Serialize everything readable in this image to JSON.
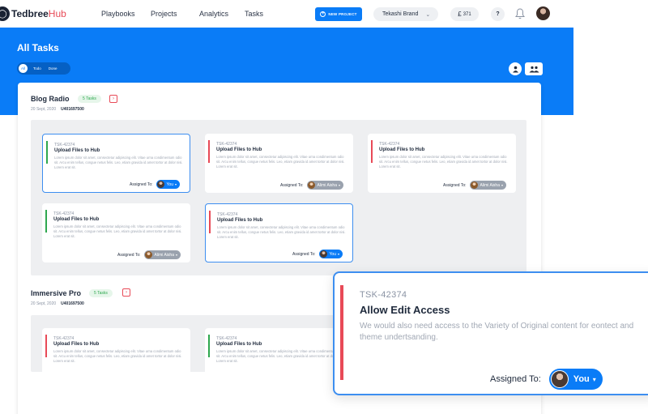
{
  "app": {
    "name": "Tedbree",
    "name_suffix": "Hub",
    "logo_icon": "tedbree-logo-icon"
  },
  "nav": {
    "links": [
      {
        "label": "Playbooks"
      },
      {
        "label": "Projects"
      },
      {
        "label": "Analytics"
      },
      {
        "label": "Tasks"
      }
    ],
    "new_project_label": "NEW PROJECT",
    "brand_select": "Tekashi Brand",
    "credit_symbol": "£",
    "credit_value": "371",
    "help_label": "?",
    "icons": [
      "plus-circle-icon",
      "chevron-down-icon",
      "question-icon",
      "bell-icon",
      "avatar"
    ]
  },
  "hero": {
    "title": "All Tasks",
    "filters": [
      {
        "label": "All",
        "active": true
      },
      {
        "label": "Todo"
      },
      {
        "label": "Done"
      }
    ],
    "view_icons": [
      "user-view-icon",
      "team-view-icon"
    ]
  },
  "colors": {
    "primary": "#0a7cf7",
    "accent_red": "#e84a57",
    "accent_green": "#2fa84f"
  },
  "projects": [
    {
      "title": "Blog Radio",
      "badge": "5 Tasks",
      "date": "20 Sept, 2020",
      "code": "U401697500",
      "tasks": [
        {
          "code": "TSK-42374",
          "title": "Upload Files to Hub",
          "desc": "Lorem ipsum dolor sit amet, consectetur adipiscing elit. Vitae urna condimentum odio sit. Arcu enim tellus, congue netus felis. Leo, etiam gravida id amet tortor at dolor nisi. Lorem erat sit.",
          "assigned_label": "Assigned To:",
          "assignee": "You",
          "status": "green",
          "selected": true
        },
        {
          "code": "TSK-42374",
          "title": "Upload Files to Hub",
          "desc": "Lorem ipsum dolor sit amet, consectetur adipiscing elit. Vitae urna condimentum odio sit. Arcu enim tellus, congue netus felis. Leo, etiam gravida id amet tortor at dolor nisi. Lorem erat sit.",
          "assigned_label": "Assigned To:",
          "assignee": "Alimi Aisha",
          "status": "red",
          "selected": false
        },
        {
          "code": "TSK-42374",
          "title": "Upload Files to Hub",
          "desc": "Lorem ipsum dolor sit amet, consectetur adipiscing elit. Vitae urna condimentum odio sit. Arcu enim tellus, congue netus felis. Leo, etiam gravida id amet tortor at dolor nisi. Lorem erat sit.",
          "assigned_label": "Assigned To:",
          "assignee": "Alimi Aisha",
          "status": "red",
          "selected": false
        },
        {
          "code": "TSK-42374",
          "title": "Upload Files to Hub",
          "desc": "Lorem ipsum dolor sit amet, consectetur adipiscing elit. Vitae urna condimentum odio sit. Arcu enim tellus, congue netus felis. Leo, etiam gravida id amet tortor at dolor nisi. Lorem erat sit.",
          "assigned_label": "Assigned To:",
          "assignee": "Alimi Aisha",
          "status": "green",
          "selected": false
        },
        {
          "code": "TSK-42374",
          "title": "Upload Files to Hub",
          "desc": "Lorem ipsum dolor sit amet, consectetur adipiscing elit. Vitae urna condimentum odio sit. Arcu enim tellus, congue netus felis. Leo, etiam gravida id amet tortor at dolor nisi. Lorem erat sit.",
          "assigned_label": "Assigned To:",
          "assignee": "You",
          "status": "red",
          "selected": true
        }
      ]
    },
    {
      "title": "Immersive Pro",
      "badge": "5 Tasks",
      "date": "20 Sept, 2020",
      "code": "U401697500",
      "tasks": [
        {
          "code": "TSK-42374",
          "title": "Upload Files to Hub",
          "desc": "Lorem ipsum dolor sit amet, consectetur adipiscing elit. Vitae urna condimentum odio sit. Arcu enim tellus, congue netus felis. Leo, etiam gravida id amet tortor at dolor nisi. Lorem erat sit.",
          "status": "red"
        },
        {
          "code": "TSK-42374",
          "title": "Upload Files to Hub",
          "desc": "Lorem ipsum dolor sit amet, consectetur adipiscing elit. Vitae urna condimentum odio sit. Arcu enim tellus, congue netus felis. Leo, etiam gravida id amet tortor at dolor nisi. Lorem erat sit.",
          "status": "green"
        }
      ]
    }
  ],
  "popover": {
    "code": "TSK-42374",
    "title": "Allow Edit Access",
    "desc": "We would also need access to the Variety of Original content for eontect and theme undertsanding.",
    "assigned_label": "Assigned To:",
    "assignee": "You"
  }
}
